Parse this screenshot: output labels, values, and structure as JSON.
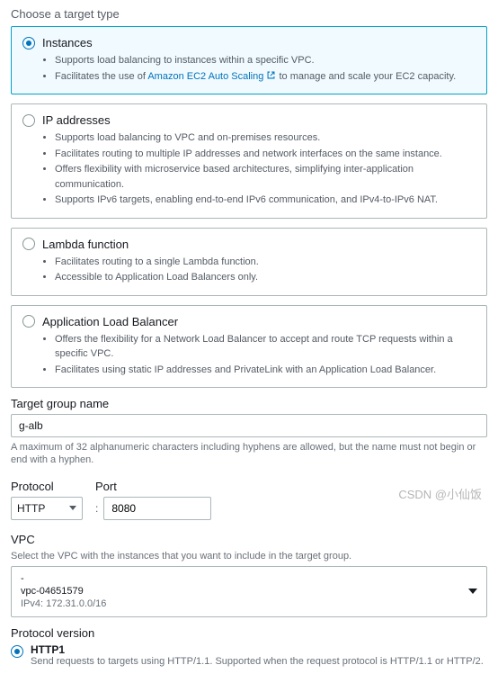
{
  "section_title": "Choose a target type",
  "options": [
    {
      "label": "Instances",
      "bullets": [
        "Supports load balancing to instances within a specific VPC.",
        "Facilitates the use of "
      ],
      "link_text": "Amazon EC2 Auto Scaling",
      "link_suffix": " to manage and scale your EC2 capacity."
    },
    {
      "label": "IP addresses",
      "bullets": [
        "Supports load balancing to VPC and on-premises resources.",
        "Facilitates routing to multiple IP addresses and network interfaces on the same instance.",
        "Offers flexibility with microservice based architectures, simplifying inter-application communication.",
        "Supports IPv6 targets, enabling end-to-end IPv6 communication, and IPv4-to-IPv6 NAT."
      ]
    },
    {
      "label": "Lambda function",
      "bullets": [
        "Facilitates routing to a single Lambda function.",
        "Accessible to Application Load Balancers only."
      ]
    },
    {
      "label": "Application Load Balancer",
      "bullets": [
        "Offers the flexibility for a Network Load Balancer to accept and route TCP requests within a specific VPC.",
        "Facilitates using static IP addresses and PrivateLink with an Application Load Balancer."
      ]
    }
  ],
  "tg_name": {
    "label": "Target group name",
    "value": "g-alb",
    "helper": "A maximum of 32 alphanumeric characters including hyphens are allowed, but the name must not begin or end with a hyphen."
  },
  "protocol": {
    "label": "Protocol",
    "value": "HTTP"
  },
  "port": {
    "label": "Port",
    "value": "8080"
  },
  "vpc": {
    "label": "VPC",
    "helper": "Select the VPC with the instances that you want to include in the target group.",
    "dash": "-",
    "id": "vpc-04651579",
    "cidr": "IPv4: 172.31.0.0/16"
  },
  "proto_version": {
    "label": "Protocol version",
    "opt1": "HTTP1",
    "opt1_help": "Send requests to targets using HTTP/1.1. Supported when the request protocol is HTTP/1.1 or HTTP/2."
  },
  "watermark": "CSDN @小仙饭"
}
